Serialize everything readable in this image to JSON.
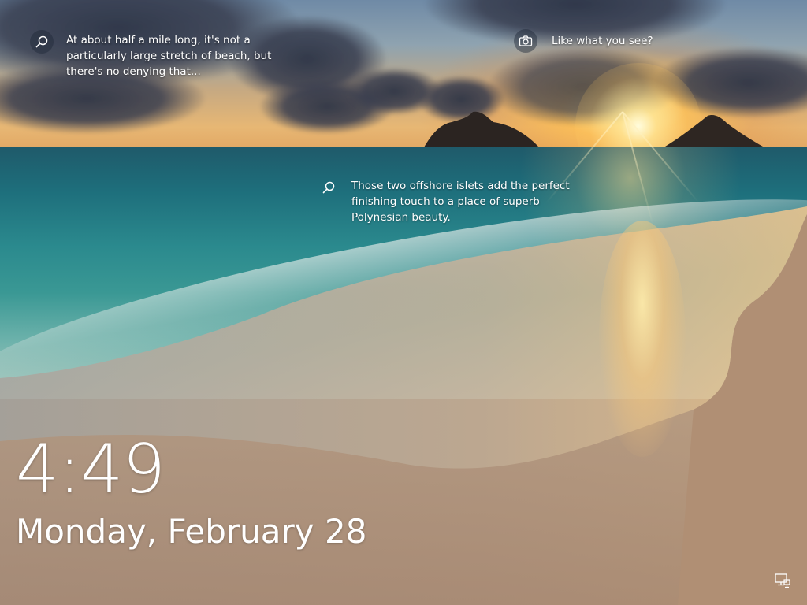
{
  "lock_screen": {
    "time": "4:49",
    "date": "Monday, February 28"
  },
  "spotlight": {
    "hotspots": [
      {
        "icon": "search-icon",
        "text": "At about half a mile long, it's not a\nparticularly large stretch of beach, but\nthere's no denying that..."
      },
      {
        "icon": "camera-icon",
        "text": "Like what you see?"
      },
      {
        "icon": "search-icon",
        "text": "Those two offshore islets add the perfect\nfinishing touch to a place of superb\nPolynesian beauty."
      }
    ]
  },
  "status": {
    "network_icon": "network-wired-icon"
  },
  "colors": {
    "text": "#ffffff",
    "sky_top": "#6f8aa6",
    "sun": "#ffe7a0",
    "ocean": "#1e6f7c",
    "sand": "#b79c84"
  }
}
